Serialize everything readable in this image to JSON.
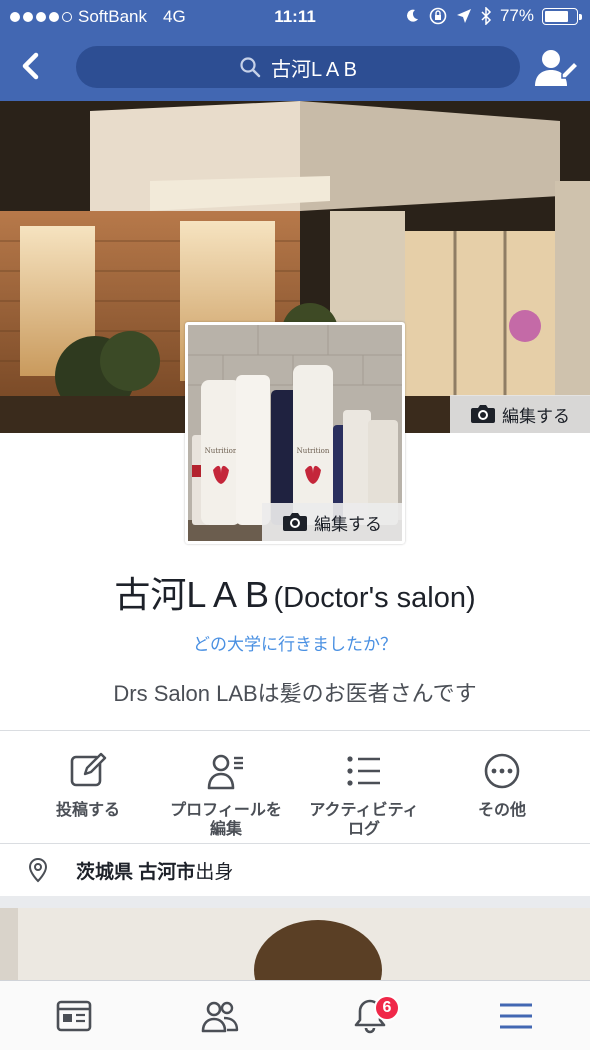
{
  "status_bar": {
    "carrier": "SoftBank",
    "network": "4G",
    "time": "11:11",
    "battery": "77%",
    "battery_level": 0.77,
    "signal_bars_filled": 4,
    "signal_bars_total": 5
  },
  "nav": {
    "search_text": "古河L A B",
    "back_icon": "chevron-left-icon",
    "friend_icon": "edit-profile-icon"
  },
  "cover": {
    "edit_label": "編集する",
    "camera_icon": "camera-icon"
  },
  "profile_picture": {
    "edit_label": "編集する",
    "camera_icon": "camera-icon"
  },
  "profile": {
    "name": "古河L A B",
    "alternate_name": "(Doctor's salon)",
    "education_prompt": "どの大学に行きましたか？",
    "bio": "Drs Salon LABは髪のお医者さんです"
  },
  "actions": [
    {
      "label": "投稿する",
      "icon": "compose-icon"
    },
    {
      "label": "プロフィールを\n編集",
      "icon": "edit-profile-icon"
    },
    {
      "label": "アクティビティ\nログ",
      "icon": "activity-log-icon"
    },
    {
      "label": "その他",
      "icon": "more-icon"
    }
  ],
  "hometown": {
    "prefecture": "茨城県",
    "city": "古河市",
    "suffix": "出身",
    "icon": "location-pin-icon"
  },
  "tabbar": {
    "tabs": [
      {
        "name": "news-feed",
        "icon": "news-feed-icon"
      },
      {
        "name": "friends",
        "icon": "friends-icon"
      },
      {
        "name": "notifications",
        "icon": "bell-icon"
      },
      {
        "name": "menu",
        "icon": "menu-icon"
      }
    ],
    "notification_count": "6"
  },
  "colors": {
    "brand": "#4267b2",
    "search_bg": "#2d4e93",
    "link": "#4a90e2",
    "badge": "#f02849",
    "active_tab": "#4267b2"
  }
}
